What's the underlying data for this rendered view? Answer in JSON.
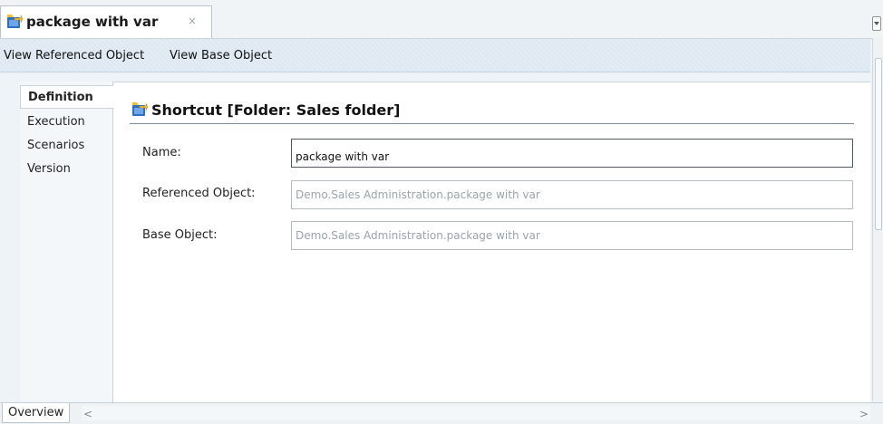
{
  "editor": {
    "tab_title": "package with var",
    "tab_close": "×",
    "tab_icon": "shortcut-package-icon"
  },
  "actions": {
    "view_referenced": "View Referenced Object",
    "view_base": "View Base Object"
  },
  "nav": {
    "items": [
      {
        "label": "Definition",
        "active": true
      },
      {
        "label": "Execution",
        "active": false
      },
      {
        "label": "Scenarios",
        "active": false
      },
      {
        "label": "Version",
        "active": false
      }
    ]
  },
  "section": {
    "title": "Shortcut [Folder: Sales folder]",
    "icon": "shortcut-package-icon"
  },
  "form": {
    "name_label": "Name:",
    "name_value": "package with var",
    "referenced_label": "Referenced Object:",
    "referenced_value": "Demo.Sales Administration.package with var",
    "base_label": "Base Object:",
    "base_value": "Demo.Sales Administration.package with var"
  },
  "bottom": {
    "overview_tab": "Overview",
    "scroll_left": "<",
    "scroll_right": ">"
  },
  "colors": {
    "link_bar": "#dde8f1",
    "accent_icon_blue": "#2e6fc2",
    "accent_icon_yellow": "#f2c12e"
  }
}
